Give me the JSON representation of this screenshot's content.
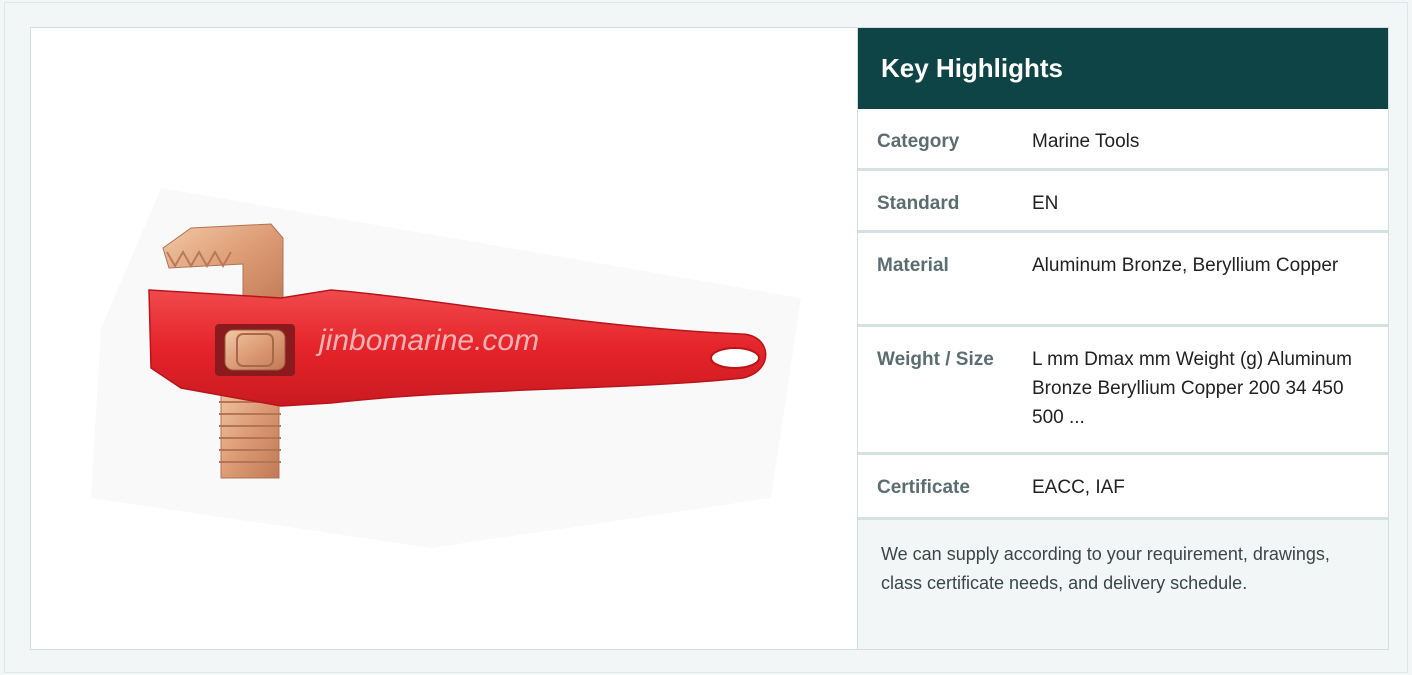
{
  "product_image": {
    "watermark": "jinbomarine.com",
    "icon": "offset-pipe-wrench-image"
  },
  "highlights": {
    "title": "Key Highlights",
    "rows": [
      {
        "label": "Category",
        "value": "Marine Tools"
      },
      {
        "label": "Standard",
        "value": "EN"
      },
      {
        "label": "Material",
        "value": "Aluminum Bronze, Beryllium Copper"
      },
      {
        "label": "Weight / Size",
        "value": "L mm Dmax mm Weight (g) Aluminum Bronze Beryllium Copper 200 34 450 500 ..."
      },
      {
        "label": "Certificate",
        "value": "EACC, IAF"
      }
    ],
    "note": "We can supply according to your requirement, drawings, class certificate needs, and delivery schedule."
  },
  "colors": {
    "header_bg": "#0f4446",
    "handle_red": "#e8262b",
    "bronze": "#e0a37c"
  }
}
